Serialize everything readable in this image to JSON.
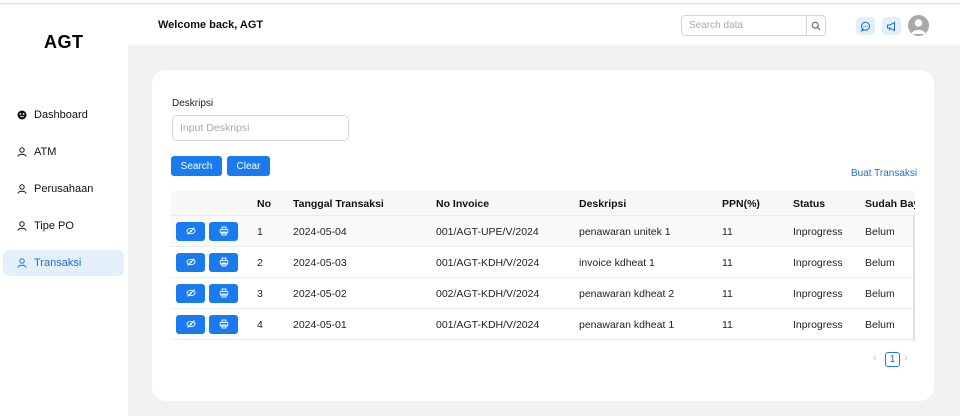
{
  "app": {
    "logo": "AGT"
  },
  "sidebar": {
    "items": [
      {
        "label": "Dashboard",
        "icon": "dashboard-icon",
        "active": false
      },
      {
        "label": "ATM",
        "icon": "user-icon",
        "active": false
      },
      {
        "label": "Perusahaan",
        "icon": "user-icon",
        "active": false
      },
      {
        "label": "Tipe PO",
        "icon": "user-icon",
        "active": false
      },
      {
        "label": "Transaksi",
        "icon": "user-icon",
        "active": true
      }
    ]
  },
  "header": {
    "welcome": "Welcome back, AGT",
    "search_placeholder": "Search data",
    "icons": [
      "message-icon",
      "megaphone-icon",
      "avatar"
    ]
  },
  "filter": {
    "label": "Deskripsi",
    "placeholder": "Input Deskripsi",
    "search_label": "Search",
    "clear_label": "Clear",
    "new_link": "Buat Transaksi"
  },
  "table": {
    "columns": [
      "No",
      "Tanggal Transaksi",
      "No Invoice",
      "Deskripsi",
      "PPN(%)",
      "Status",
      "Sudah Bay"
    ],
    "rows": [
      {
        "no": "1",
        "date": "2024-05-04",
        "invoice": "001/AGT-UPE/V/2024",
        "desc": "penawaran unitek 1",
        "ppn": "11",
        "status": "Inprogress",
        "paid": "Belum"
      },
      {
        "no": "2",
        "date": "2024-05-03",
        "invoice": "001/AGT-KDH/V/2024",
        "desc": "invoice kdheat 1",
        "ppn": "11",
        "status": "Inprogress",
        "paid": "Belum"
      },
      {
        "no": "3",
        "date": "2024-05-02",
        "invoice": "002/AGT-KDH/V/2024",
        "desc": "penawaran kdheat 2",
        "ppn": "11",
        "status": "Inprogress",
        "paid": "Belum"
      },
      {
        "no": "4",
        "date": "2024-05-01",
        "invoice": "001/AGT-KDH/V/2024",
        "desc": "penawaran kdheat 1",
        "ppn": "11",
        "status": "Inprogress",
        "paid": "Belum"
      }
    ],
    "actions": [
      "eye-slash-icon",
      "printer-icon"
    ]
  },
  "pagination": {
    "prev": "‹",
    "current": "1",
    "next": "›"
  },
  "colors": {
    "primary": "#1a7bef",
    "active_bg": "#e3f0fb",
    "page_bg": "#f2f2f2"
  }
}
